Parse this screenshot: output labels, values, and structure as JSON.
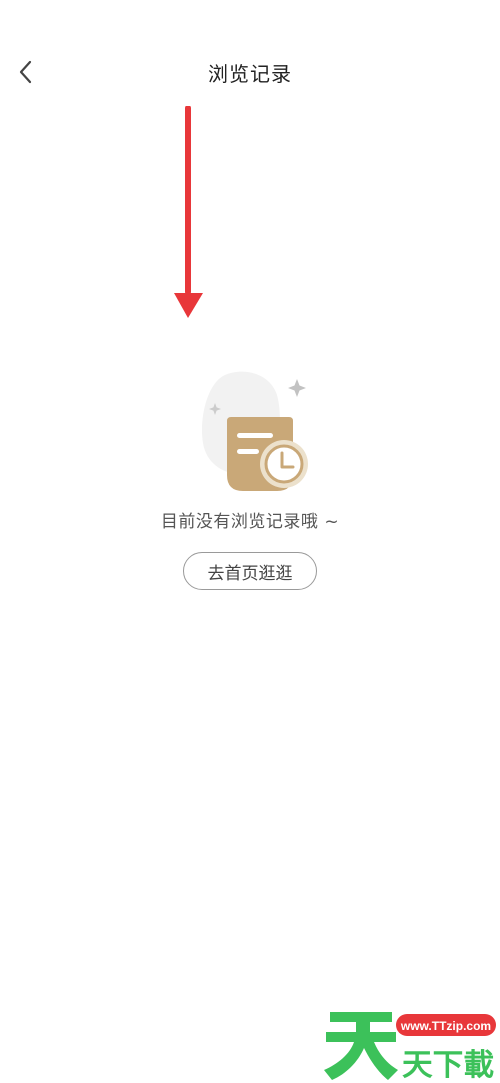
{
  "header": {
    "back_icon": "chevron-left-icon",
    "title": "浏览记录"
  },
  "annotation": {
    "arrow_icon": "down-arrow-icon",
    "arrow_color": "#e8373a"
  },
  "empty_state": {
    "illustration_icon": "document-clock-icon",
    "illustration_color": "#c9a878",
    "message": "目前没有浏览记录哦 ~",
    "button_label": "去首页逛逛"
  },
  "watermark": {
    "logo_icon": "ttzip-logo",
    "url_text": "www.TTzip.com",
    "brand_text": "天下載",
    "brand_color": "#3cc15a",
    "url_badge_color": "#e8373a"
  }
}
